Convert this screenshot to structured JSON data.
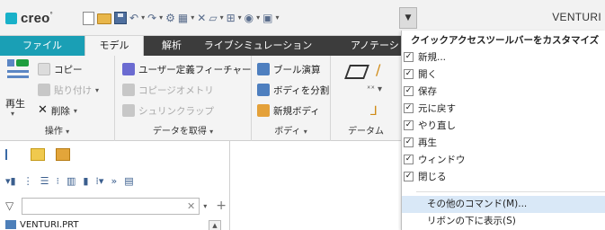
{
  "app": {
    "logo": "creo",
    "logo_mark": "°",
    "title": "VENTURI",
    "qat_dropdown": "▼"
  },
  "tabs": [
    {
      "label": "ファイル"
    },
    {
      "label": "モデル"
    },
    {
      "label": "解析"
    },
    {
      "label": "ライブシミュレーション"
    },
    {
      "label": "アノテーシ"
    }
  ],
  "ribbon": {
    "ops": {
      "footer": "操作",
      "regen": "再生",
      "copy": "コピー",
      "paste": "貼り付け",
      "delete": "削除"
    },
    "data": {
      "footer": "データを取得",
      "udf": "ユーザー定義フィーチャー",
      "copy_geom": "コピージオメトリ",
      "shrinkwrap": "シュリンクラップ"
    },
    "body": {
      "footer": "ボディ",
      "boolean": "ブール演算",
      "split": "ボディを分割",
      "new_body": "新規ボディ"
    },
    "anno": {
      "footer": "データム"
    }
  },
  "panel": {
    "search_placeholder": "",
    "tree_item": "VENTURI.PRT"
  },
  "menu": {
    "header": "クイックアクセスツールバーをカスタマイズ",
    "items": [
      {
        "label": "新規...",
        "checked": true
      },
      {
        "label": "開く",
        "checked": true
      },
      {
        "label": "保存",
        "checked": true
      },
      {
        "label": "元に戻す",
        "checked": true
      },
      {
        "label": "やり直し",
        "checked": true
      },
      {
        "label": "再生",
        "checked": true
      },
      {
        "label": "ウィンドウ",
        "checked": true
      },
      {
        "label": "閉じる",
        "checked": true
      }
    ],
    "more_commands": "その他のコマンド(M)...",
    "show_below": "リボンの下に表示(S)"
  },
  "colors": {
    "file_tab": "#1a9fb5",
    "tabbar": "#3c3c3c",
    "ribbon": "#f4f4f4",
    "menu_highlight": "#d9e8f7"
  }
}
